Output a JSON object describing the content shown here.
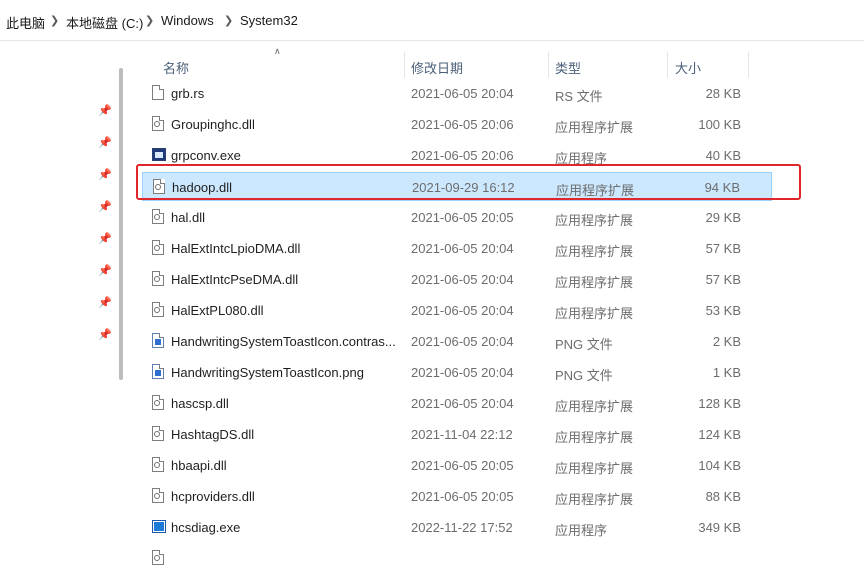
{
  "breadcrumb": {
    "items": [
      "此电脑",
      "本地磁盘 (C:)",
      "Windows",
      "System32"
    ]
  },
  "columns": {
    "name": "名称",
    "date": "修改日期",
    "type": "类型",
    "size": "大小"
  },
  "files": [
    {
      "name": "grb.rs",
      "date": "2021-06-05 20:04",
      "type": "RS 文件",
      "size": "28 KB",
      "icon": "file-icon",
      "selected": false
    },
    {
      "name": "Groupinghc.dll",
      "date": "2021-06-05 20:06",
      "type": "应用程序扩展",
      "size": "100 KB",
      "icon": "dll-icon",
      "selected": false
    },
    {
      "name": "grpconv.exe",
      "date": "2021-06-05 20:06",
      "type": "应用程序",
      "size": "40 KB",
      "icon": "exe-icon",
      "selected": false
    },
    {
      "name": "hadoop.dll",
      "date": "2021-09-29 16:12",
      "type": "应用程序扩展",
      "size": "94 KB",
      "icon": "dll-icon",
      "selected": true
    },
    {
      "name": "hal.dll",
      "date": "2021-06-05 20:05",
      "type": "应用程序扩展",
      "size": "29 KB",
      "icon": "dll-icon",
      "selected": false
    },
    {
      "name": "HalExtIntcLpioDMA.dll",
      "date": "2021-06-05 20:04",
      "type": "应用程序扩展",
      "size": "57 KB",
      "icon": "dll-icon",
      "selected": false
    },
    {
      "name": "HalExtIntcPseDMA.dll",
      "date": "2021-06-05 20:04",
      "type": "应用程序扩展",
      "size": "57 KB",
      "icon": "dll-icon",
      "selected": false
    },
    {
      "name": "HalExtPL080.dll",
      "date": "2021-06-05 20:04",
      "type": "应用程序扩展",
      "size": "53 KB",
      "icon": "dll-icon",
      "selected": false
    },
    {
      "name": "HandwritingSystemToastIcon.contras...",
      "date": "2021-06-05 20:04",
      "type": "PNG 文件",
      "size": "2 KB",
      "icon": "png-icon",
      "selected": false
    },
    {
      "name": "HandwritingSystemToastIcon.png",
      "date": "2021-06-05 20:04",
      "type": "PNG 文件",
      "size": "1 KB",
      "icon": "png-icon",
      "selected": false
    },
    {
      "name": "hascsp.dll",
      "date": "2021-06-05 20:04",
      "type": "应用程序扩展",
      "size": "128 KB",
      "icon": "dll-icon",
      "selected": false
    },
    {
      "name": "HashtagDS.dll",
      "date": "2021-11-04 22:12",
      "type": "应用程序扩展",
      "size": "124 KB",
      "icon": "dll-icon",
      "selected": false
    },
    {
      "name": "hbaapi.dll",
      "date": "2021-06-05 20:05",
      "type": "应用程序扩展",
      "size": "104 KB",
      "icon": "dll-icon",
      "selected": false
    },
    {
      "name": "hcproviders.dll",
      "date": "2021-06-05 20:05",
      "type": "应用程序扩展",
      "size": "88 KB",
      "icon": "dll-icon",
      "selected": false
    },
    {
      "name": "hcsdiag.exe",
      "date": "2022-11-22 17:52",
      "type": "应用程序",
      "size": "349 KB",
      "icon": "exe2-icon",
      "selected": false
    },
    {
      "name": "",
      "date": "",
      "type": "",
      "size": "",
      "icon": "dll-icon",
      "selected": false
    }
  ],
  "colors": {
    "selection_bg": "#cce8ff",
    "selection_border": "#99d1ff",
    "highlight_box": "#e0262a"
  }
}
